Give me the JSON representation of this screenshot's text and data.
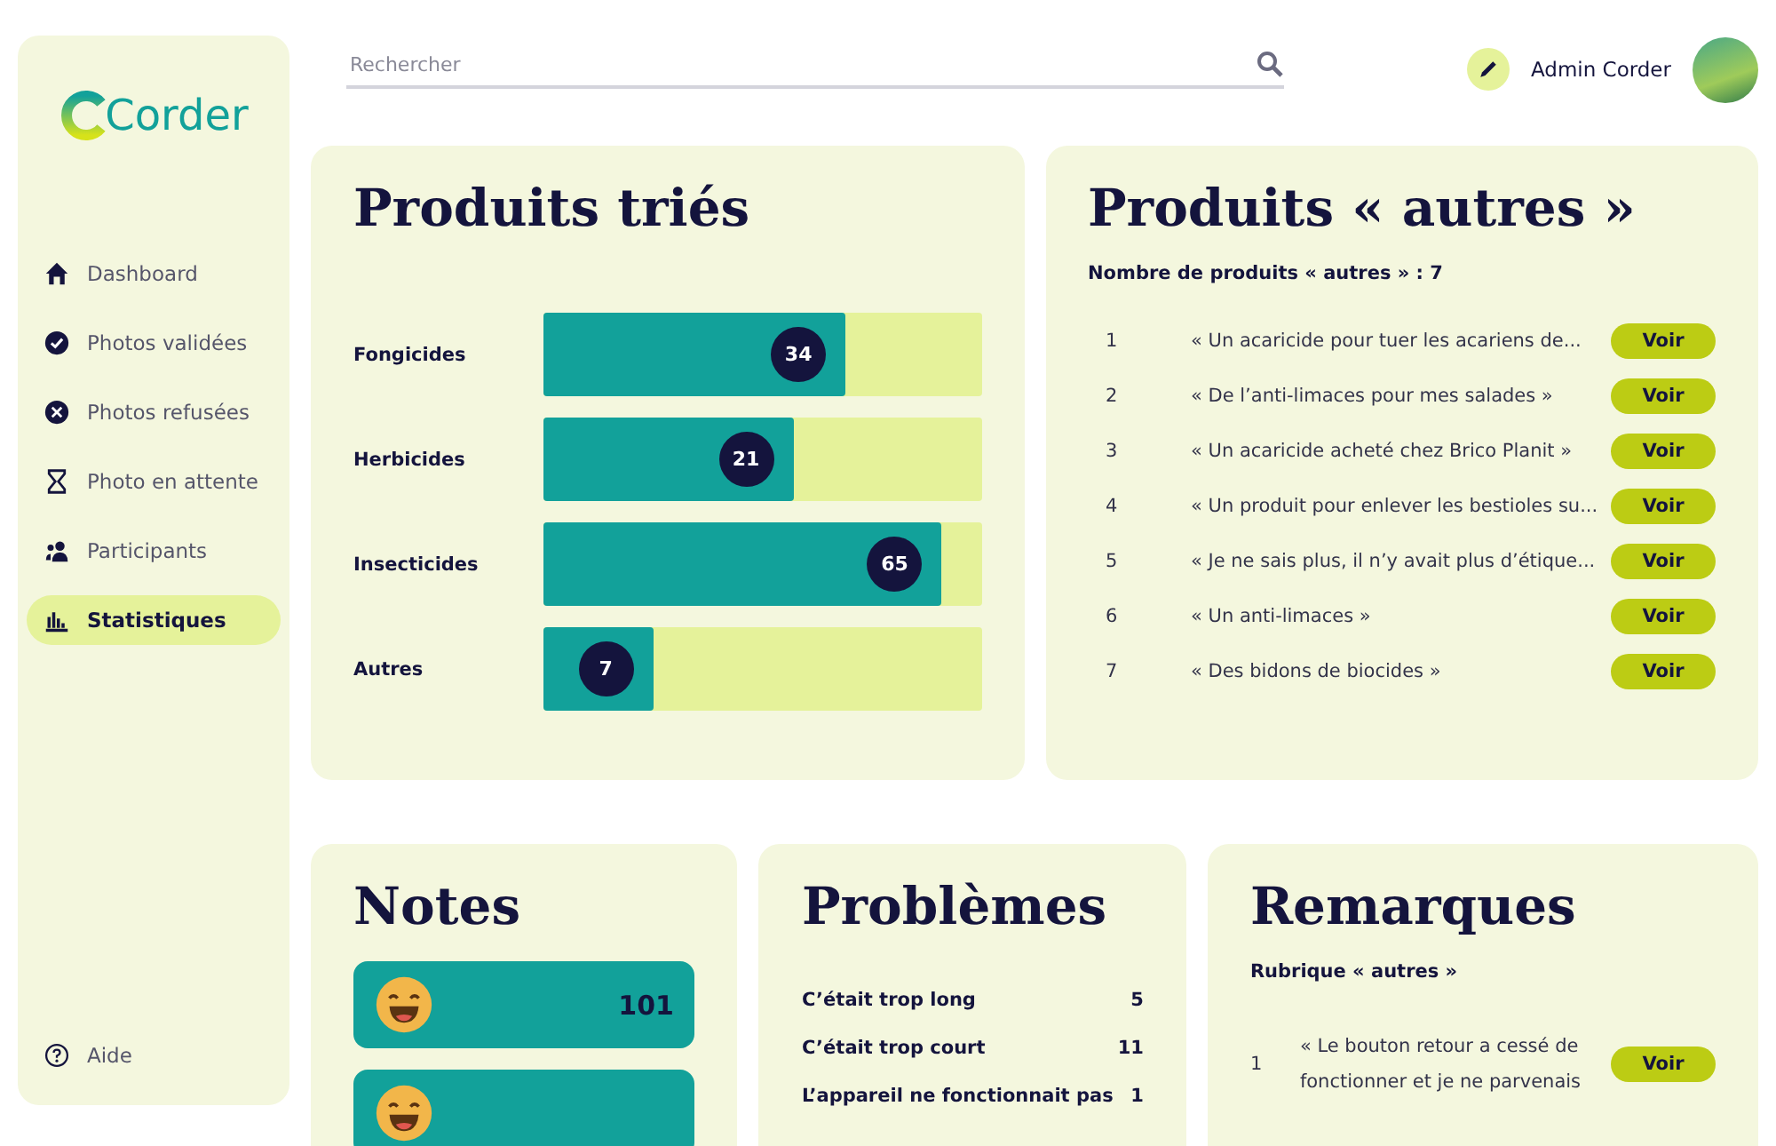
{
  "sidebar": {
    "logo": "Corder",
    "items": [
      {
        "label": "Dashboard",
        "kind": "home",
        "selected": false
      },
      {
        "label": "Photos validées",
        "kind": "check",
        "selected": false
      },
      {
        "label": "Photos refusées",
        "kind": "cross",
        "selected": false
      },
      {
        "label": "Photo en attente",
        "kind": "hourglass",
        "selected": false
      },
      {
        "label": "Participants",
        "kind": "people",
        "selected": false
      },
      {
        "label": "Statistiques",
        "kind": "chart",
        "selected": true
      }
    ],
    "help": "Aide"
  },
  "search": {
    "placeholder": "Rechercher"
  },
  "user": {
    "name": "Admin Corder"
  },
  "sorted": {
    "title": "Produits triés",
    "items": [
      {
        "label": "Fongicides",
        "count": "34",
        "level": 0.69
      },
      {
        "label": "Herbicides",
        "count": "21",
        "level": 0.57
      },
      {
        "label": "Insecticides",
        "count": "65",
        "level": 0.91
      },
      {
        "label": "Autres",
        "count": "7",
        "level": 0.25
      }
    ]
  },
  "others": {
    "title": "Produits « autres »",
    "summary": "Nombre de produits  « autres » : 7",
    "rows": [
      {
        "num": "1",
        "text": "« Un acaricide pour tuer les acariens de...",
        "action": "Voir"
      },
      {
        "num": "2",
        "text": "« De l’anti-limaces pour mes salades »",
        "action": "Voir"
      },
      {
        "num": "3",
        "text": "« Un acaricide acheté chez Brico Planit »",
        "action": "Voir"
      },
      {
        "num": "4",
        "text": "« Un produit pour enlever les bestioles su...",
        "action": "Voir"
      },
      {
        "num": "5",
        "text": "« Je ne sais plus, il n’y avait plus d’étique...",
        "action": "Voir"
      },
      {
        "num": "6",
        "text": "« Un anti-limaces »",
        "action": "Voir"
      },
      {
        "num": "7",
        "text": "« Des bidons de biocides »",
        "action": "Voir"
      }
    ]
  },
  "notes": {
    "title": "Notes",
    "rows": [
      {
        "count": "101"
      },
      {}
    ]
  },
  "problems": {
    "title": "Problèmes",
    "rows": [
      {
        "label": "C’était trop long",
        "count": "5"
      },
      {
        "label": "C’était trop court",
        "count": "11"
      },
      {
        "label": "L’appareil ne fonctionnait pas",
        "count": "1"
      }
    ]
  },
  "remarks": {
    "title": "Remarques",
    "subtitle": "Rubrique « autres »",
    "rows": [
      {
        "num": "1",
        "text": "« Le bouton retour a cessé de fonctionner et je ne parvenais",
        "action": "Voir"
      }
    ]
  }
}
